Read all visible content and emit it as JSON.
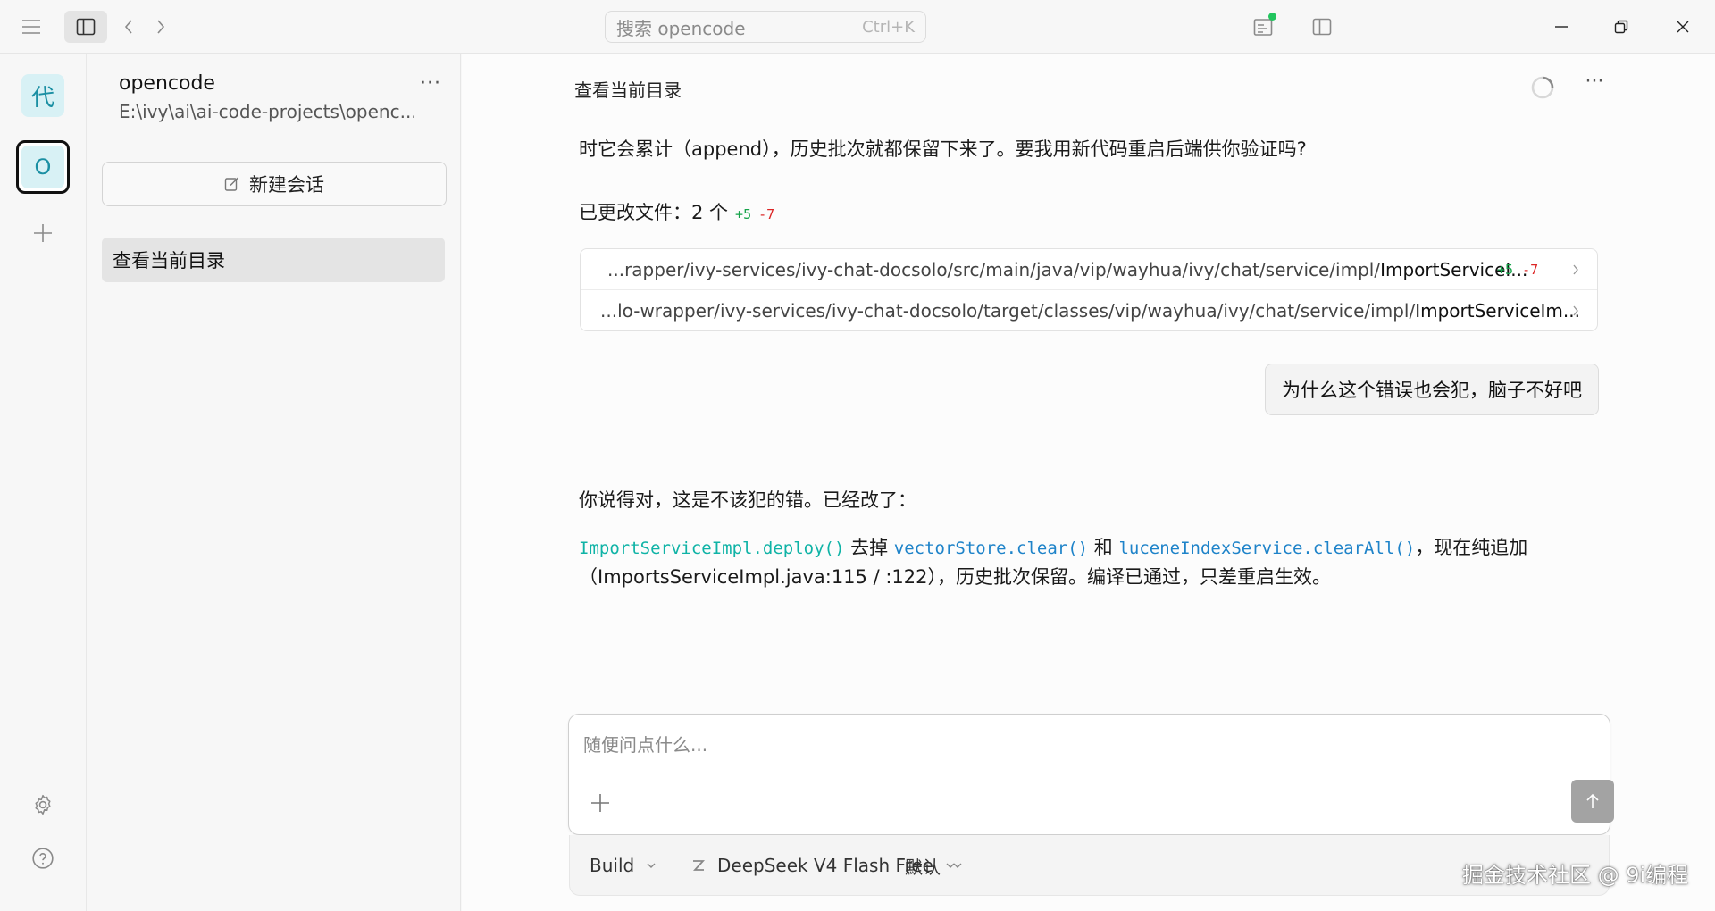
{
  "titlebar": {
    "search_placeholder": "搜索 opencode",
    "search_shortcut": "Ctrl+K",
    "status_color": "#22c55e"
  },
  "rail": {
    "avatar_label": "代",
    "project_label": "O"
  },
  "sidebar": {
    "project_name": "opencode",
    "project_path": "E:\\ivy\\ai\\ai-code-projects\\openc...",
    "more_label": "···",
    "new_session_label": "新建会话",
    "sessions": [
      {
        "title": "查看当前目录",
        "active": true
      }
    ]
  },
  "main": {
    "title": "查看当前目录",
    "more_label": "···",
    "messages": {
      "assistant_tail": "时它会累计（append），历史批次就都保留下来了。要我用新代码重启后端供你验证吗?",
      "changed_files_label": "已更改文件：2 个",
      "changed_add": "+5",
      "changed_del": "-7",
      "files": [
        {
          "path_prefix": "...rapper/ivy-services/ivy-chat-docsolo/src/main/java/vip/wayhua/ivy/chat/service/impl/",
          "file_name": "ImportServiceI...",
          "add": "+5",
          "del": "-7"
        },
        {
          "path_prefix": "...lo-wrapper/ivy-services/ivy-chat-docsolo/target/classes/vip/wayhua/ivy/chat/service/impl/",
          "file_name": "ImportServiceIm..."
        }
      ],
      "user_message": "为什么这个错误也会犯，脑子不好吧",
      "reply_line1": "你说得对，这是不该犯的错。已经改了：",
      "reply_code1": "ImportServiceImpl.deploy()",
      "reply_text1": " 去掉 ",
      "reply_code2": "vectorStore.clear()",
      "reply_text2": " 和 ",
      "reply_code3": "luceneIndexService.clearAll()",
      "reply_text3": "，现在纯追加",
      "reply_line3": "（ImportsServiceImpl.java:115 / :122），历史批次保留。编译已通过，只差重启生效。"
    }
  },
  "composer": {
    "placeholder": "随便问点什么...",
    "agent": "Build",
    "model": "DeepSeek V4 Flash Free",
    "variant": "默认"
  },
  "watermark": "掘金技术社区 @ 9i编程",
  "icons": {
    "menu": "hamburger-icon",
    "sidebar_toggle": "sidebar-toggle-icon",
    "back": "chevron-left-icon",
    "forward": "chevron-right-icon",
    "review": "review-list-icon",
    "panel": "panel-right-icon",
    "minimize": "minimize-icon",
    "maximize": "restore-icon",
    "close": "close-icon",
    "add": "plus-icon",
    "settings": "gear-icon",
    "help": "question-circle-icon",
    "edit": "edit-icon",
    "spinner": "loading-spinner-icon",
    "send": "arrow-up-icon",
    "model": "model-logo-icon"
  }
}
